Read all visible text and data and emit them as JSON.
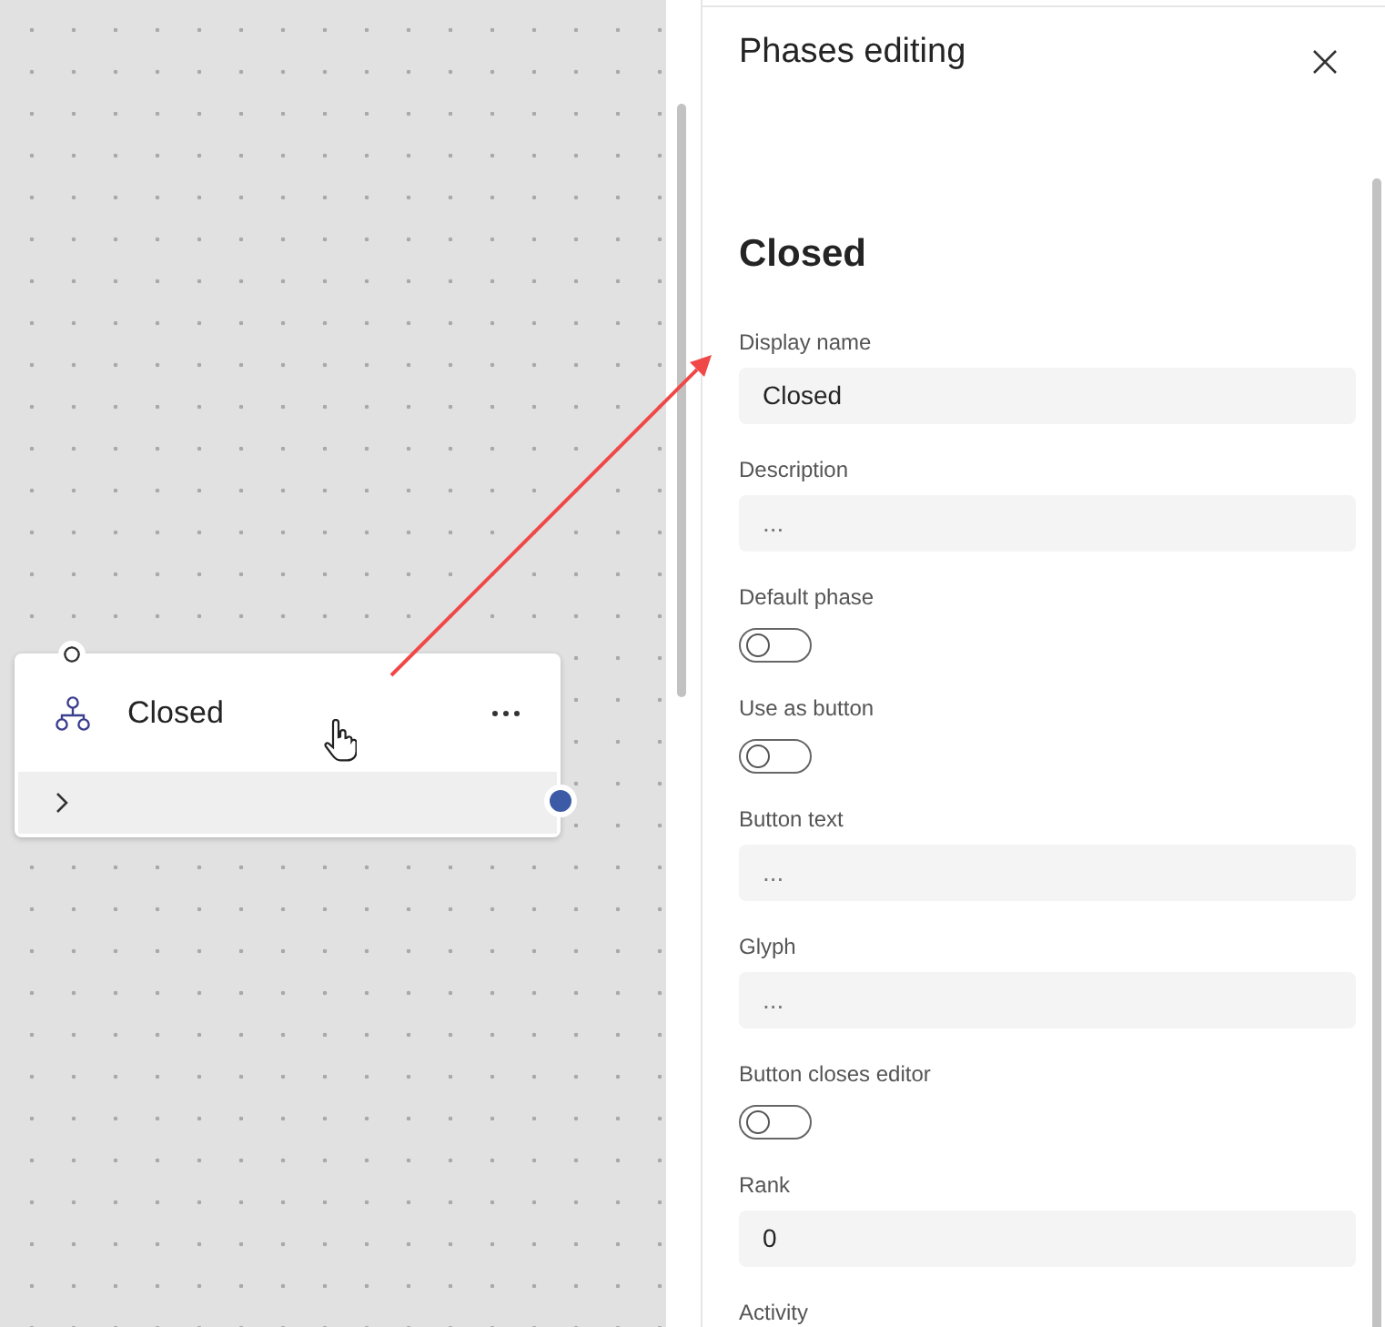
{
  "canvas": {
    "node": {
      "title": "Closed",
      "expanded": false
    }
  },
  "panel": {
    "title": "Phases editing",
    "heading": "Closed",
    "fields": [
      {
        "kind": "text",
        "label": "Display name",
        "value": "Closed"
      },
      {
        "kind": "text",
        "label": "Description",
        "placeholder": "..."
      },
      {
        "kind": "toggle",
        "label": "Default phase",
        "on": false
      },
      {
        "kind": "toggle",
        "label": "Use as button",
        "on": false
      },
      {
        "kind": "text",
        "label": "Button text",
        "placeholder": "..."
      },
      {
        "kind": "text",
        "label": "Glyph",
        "placeholder": "..."
      },
      {
        "kind": "toggle",
        "label": "Button closes editor",
        "on": false
      },
      {
        "kind": "text",
        "label": "Rank",
        "value": "0"
      },
      {
        "kind": "label",
        "label": "Activity"
      }
    ]
  }
}
